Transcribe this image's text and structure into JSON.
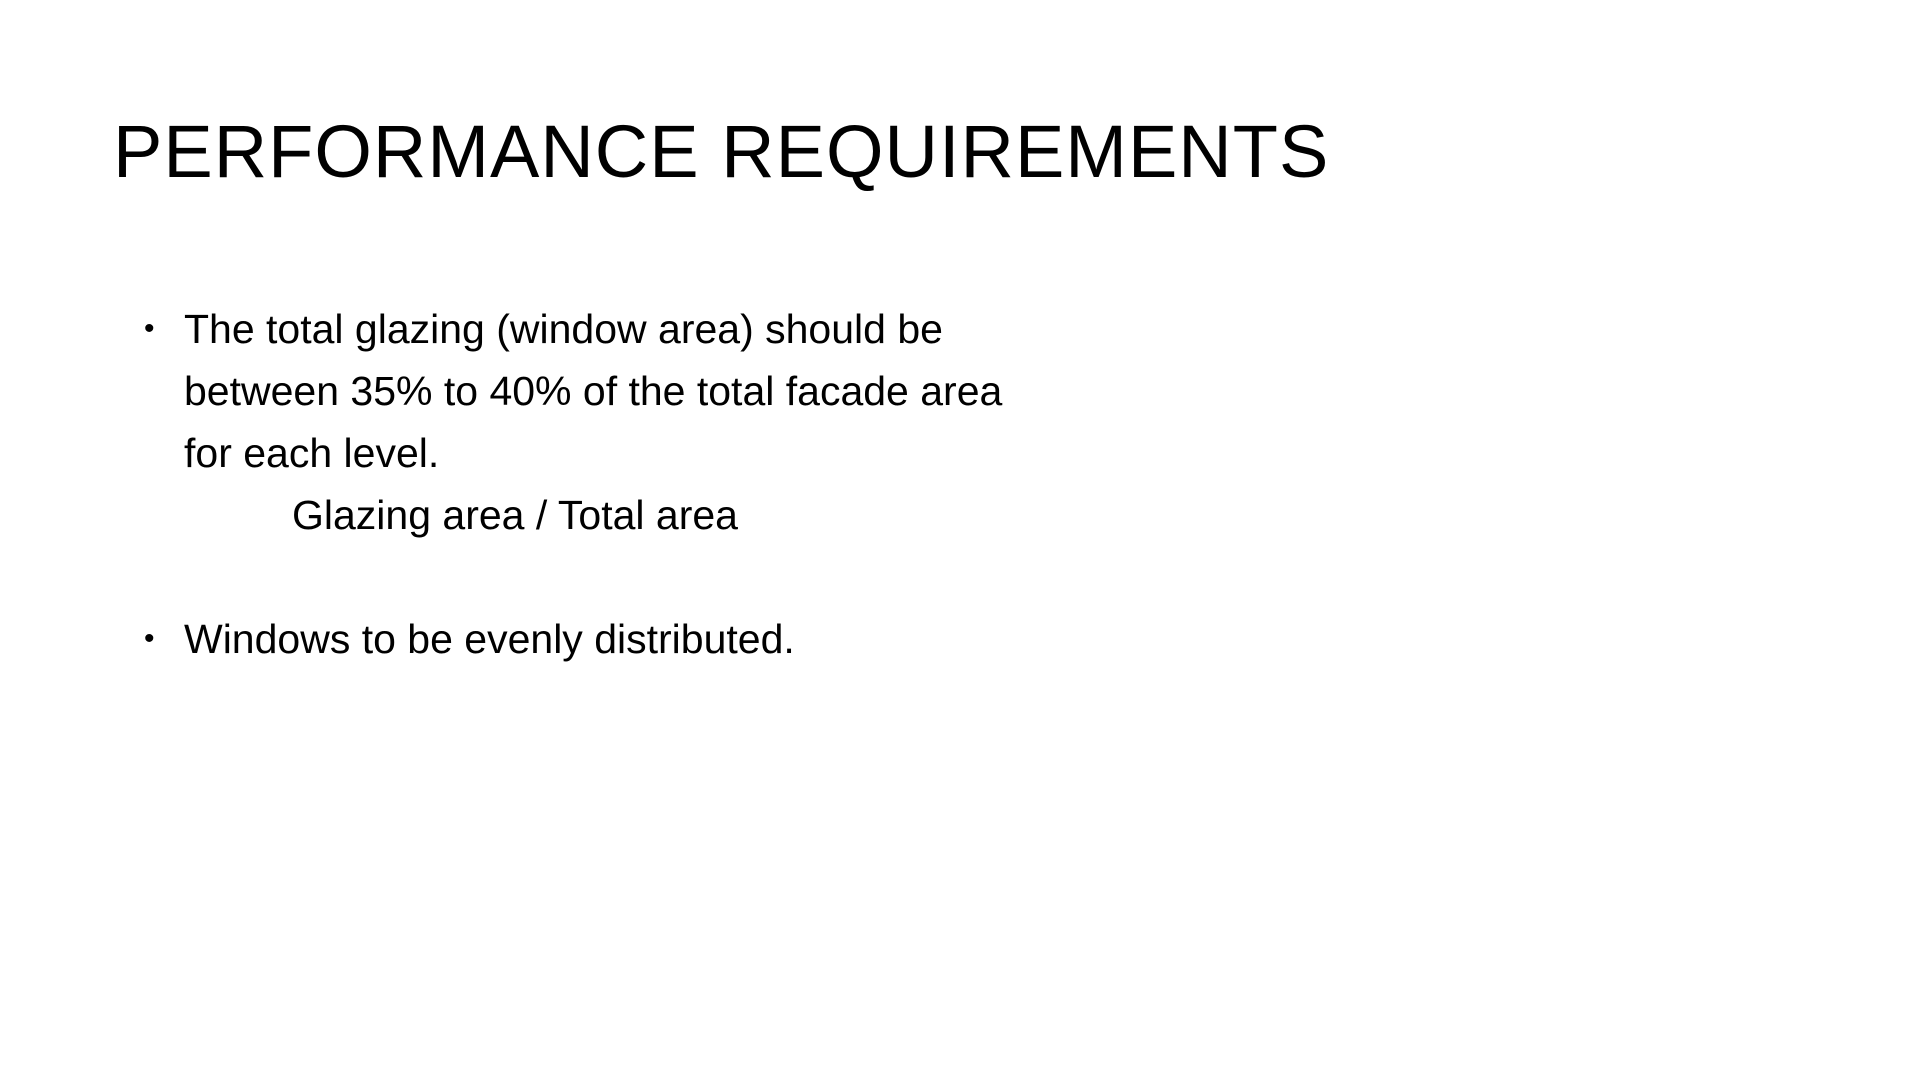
{
  "slide": {
    "title": "PERFORMANCE REQUIREMENTS",
    "bullets": [
      {
        "lines": [
          "The total glazing (window area) should be",
          "between 35% to 40% of the total facade area",
          "for each level."
        ],
        "sub_line": "Glazing area / Total area"
      },
      {
        "lines": [
          "Windows to be evenly distributed."
        ]
      }
    ],
    "bullet_glyph": "•",
    "colors": {
      "background": "#ffffff",
      "text": "#000000"
    }
  }
}
